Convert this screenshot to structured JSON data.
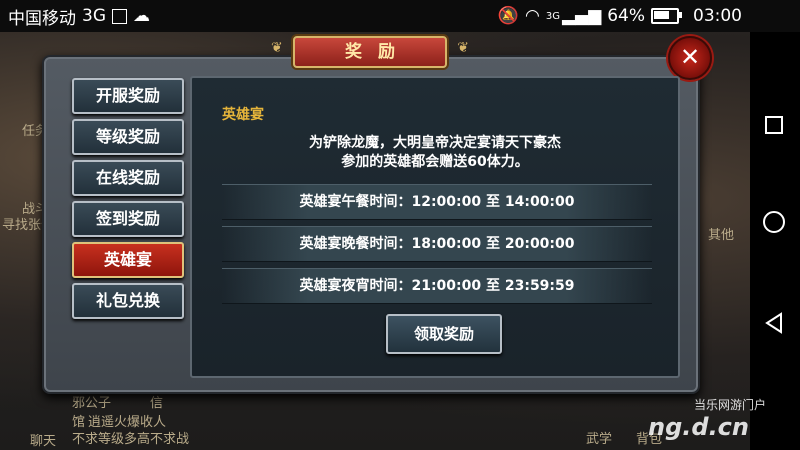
{
  "status_bar": {
    "carrier": "中国移动",
    "network": "3G",
    "signal_label": "3G",
    "battery": "64%",
    "time": "03:00"
  },
  "background": {
    "snippets": [
      "任务",
      "战斗",
      "寻找张作",
      "其他",
      "聊天",
      "邪公子",
      "信",
      "馆",
      "逍遥火爆收人",
      "不求等级多高不求战",
      "武学",
      "背包"
    ]
  },
  "dialog": {
    "title": "奖励",
    "close_icon": "close-x",
    "menu": [
      {
        "label": "开服奖励",
        "active": false
      },
      {
        "label": "等级奖励",
        "active": false
      },
      {
        "label": "在线奖励",
        "active": false
      },
      {
        "label": "签到奖励",
        "active": false
      },
      {
        "label": "英雄宴",
        "active": true
      },
      {
        "label": "礼包兑换",
        "active": false
      }
    ],
    "content": {
      "title": "英雄宴",
      "desc_line1": "为铲除龙魔，大明皇帝决定宴请天下豪杰",
      "desc_line2": "参加的英雄都会赠送60体力。",
      "times": [
        "英雄宴午餐时间：12:00:00 至 14:00:00",
        "英雄宴晚餐时间：18:00:00 至 20:00:00",
        "英雄宴夜宵时间：21:00:00 至 23:59:59"
      ],
      "claim_label": "领取奖励"
    }
  },
  "watermark": {
    "line1": "当乐网游门户",
    "line2": "ng.d.cn"
  },
  "colors": {
    "active_menu": "#c8301f",
    "title_gold": "#e6b53a",
    "close_red": "#c8271b"
  }
}
